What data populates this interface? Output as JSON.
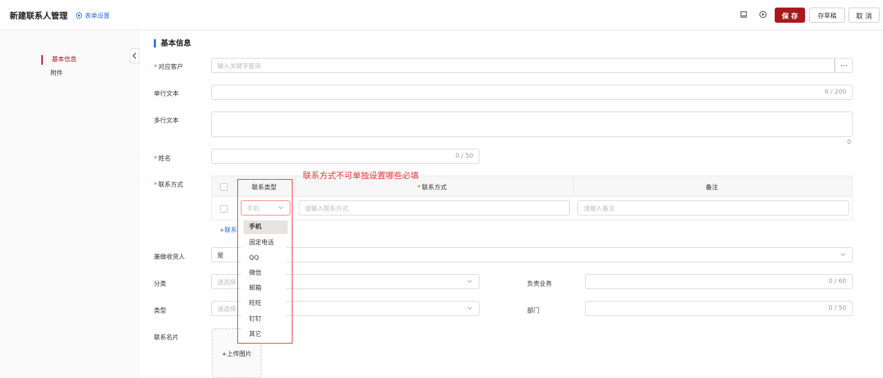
{
  "header": {
    "title": "新建联系人管理",
    "form_settings": "表单设置",
    "save": "保 存",
    "draft": "存草稿",
    "cancel": "取 消"
  },
  "sidebar": {
    "items": [
      {
        "label": "基本信息"
      },
      {
        "label": "附件"
      }
    ]
  },
  "form": {
    "section_title": "基本信息",
    "customer": {
      "label": "对应客户",
      "placeholder": "输入关键字查询",
      "ellipsis": "···"
    },
    "single_text": {
      "label": "单行文本",
      "counter": "0 / 200"
    },
    "multi_text": {
      "label": "多行文本",
      "counter": "0"
    },
    "name": {
      "label": "姓名",
      "counter": "0 / 50"
    },
    "contact": {
      "label": "联系方式",
      "columns": {
        "type": "联系类型",
        "method": "联系方式",
        "note": "备注"
      },
      "row": {
        "type_value": "手机",
        "method_placeholder": "请输入联系方式",
        "note_placeholder": "请输入备注"
      },
      "add_link": "+联系"
    },
    "receiver": {
      "label": "兼做收货人",
      "value": "是"
    },
    "category": {
      "label": "分类",
      "placeholder": "请选择"
    },
    "business": {
      "label": "负责业务",
      "counter": "0 / 60"
    },
    "type": {
      "label": "类型",
      "placeholder": "请选择"
    },
    "department": {
      "label": "部门",
      "counter": "0 / 50"
    },
    "card": {
      "label": "联系名片",
      "upload": "+上传图片"
    }
  },
  "dropdown": {
    "options": [
      "手机",
      "固定电话",
      "QQ",
      "微信",
      "邮箱",
      "旺旺",
      "钉钉",
      "其它"
    ],
    "selected": "手机"
  },
  "annotation": {
    "text": "联系方式不可单独设置哪些必填",
    "color": "#e33333"
  },
  "colors": {
    "accent": "#a8191e",
    "link": "#2a6fdb"
  }
}
